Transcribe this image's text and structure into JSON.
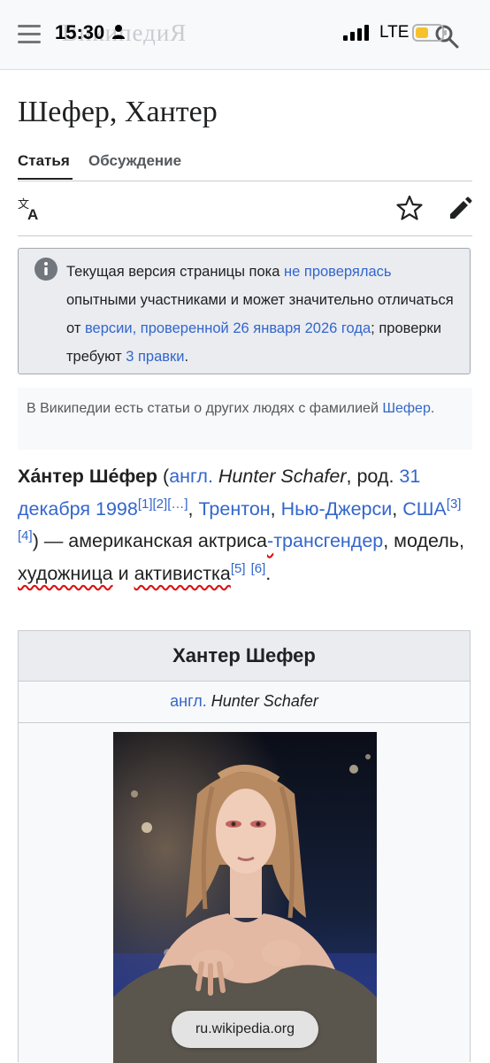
{
  "status_bar": {
    "time": "15:30",
    "network": "LTE",
    "colors": {
      "battery": "#f6c22b"
    }
  },
  "header": {
    "logo_text": "ВикипедиЯ",
    "icons": [
      "menu-icon",
      "search-icon"
    ]
  },
  "page": {
    "title": "Шефер, Хантер",
    "tabs": [
      {
        "label": "Статья",
        "active": true
      },
      {
        "label": "Обсуждение",
        "active": false
      }
    ],
    "toolbar_icons": [
      "translate-icon",
      "star-icon",
      "edit-icon"
    ]
  },
  "notice": {
    "t1": "Текущая версия страницы пока ",
    "l1": "не проверялась",
    "t2": " опытными участниками и может значительно отличаться от ",
    "l2": "версии, проверенной 26 января 2026 года",
    "t3": "; проверки требуют ",
    "l3": "3 правки",
    "t4": "."
  },
  "hatnote": {
    "text": "В Википедии есть статьи о других людях с фамилией ",
    "link": "Шефер",
    "end": "."
  },
  "lead": {
    "name": "Ха́нтер Ше́фер",
    "open_paren": " (",
    "lang_abbr": "англ.",
    "native_name": "Hunter Schafer",
    "born": ", род. ",
    "birth_date": "31 декабря 1998",
    "ref1": "[1]",
    "ref2": "[2]",
    "ref3": "[…]",
    "comma1": ", ",
    "city": "Трентон",
    "comma2": ", ",
    "state": "Нью-Джерси",
    "comma3": ", ",
    "country": "США",
    "ref4": "[3]",
    "ref5": "[4]",
    "desc1": ") — американская ",
    "actress_a": "актриса",
    "actress_b": "-",
    "transgender": "трансгендер",
    "desc2": ", модель, ",
    "artist": "художница",
    "desc3": " и ",
    "activist": "активистка",
    "ref6": "[5]",
    "ref7": "[6]",
    "end": "."
  },
  "infobox": {
    "title": "Хантер Шефер",
    "lang_abbr": "англ.",
    "native_name": "Hunter Schafer"
  },
  "browser": {
    "url": "ru.wikipedia.org"
  }
}
